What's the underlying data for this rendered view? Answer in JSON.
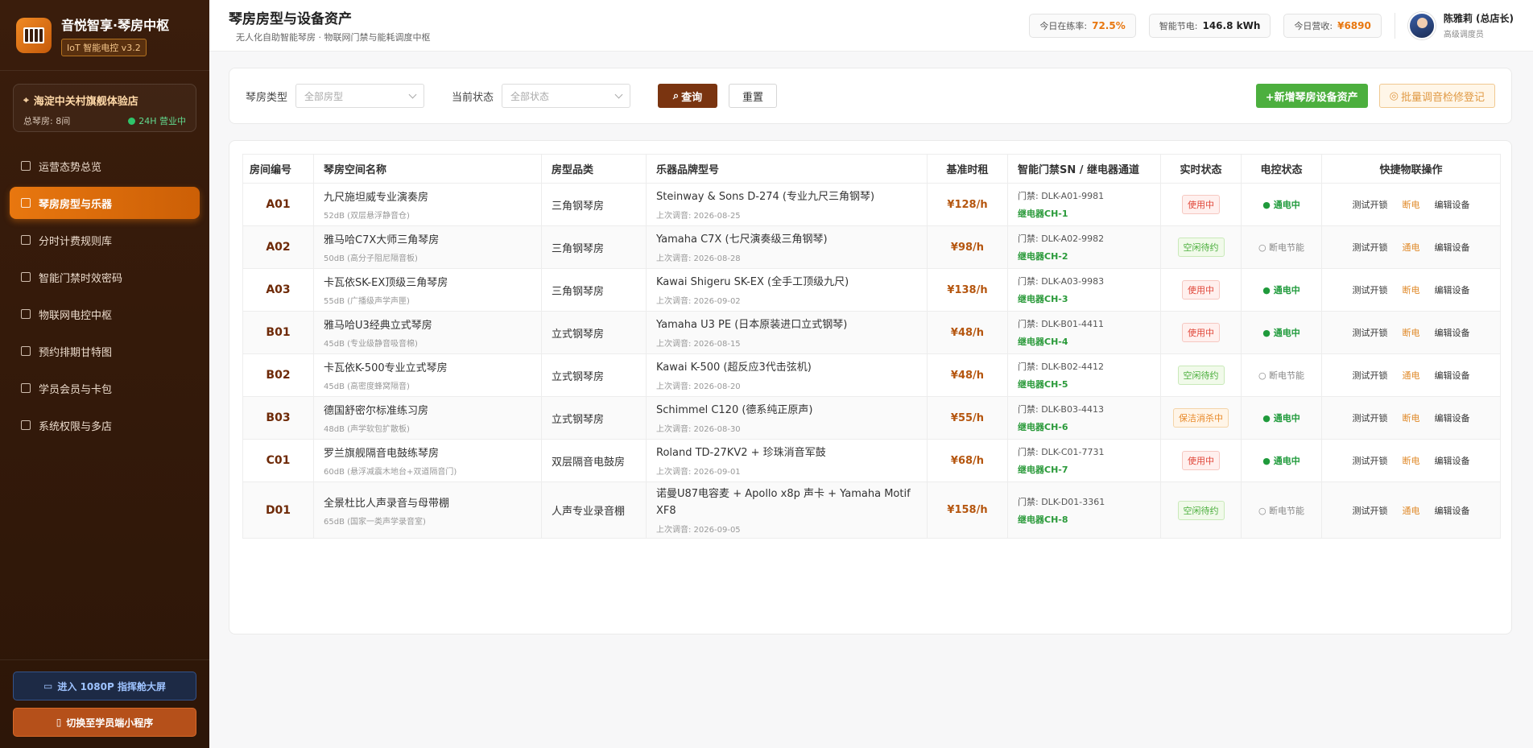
{
  "brand": {
    "title": "音悦智享·琴房中枢",
    "badge": "IoT 智能电控 v3.2"
  },
  "store": {
    "name": "海淀中关村旗舰体验店",
    "rooms_label": "总琴房: 8间",
    "open_label": "24H 营业中"
  },
  "nav": [
    {
      "label": "运营态势总览",
      "icon": "chart-icon",
      "active": false
    },
    {
      "label": "琴房房型与乐器",
      "icon": "home-icon",
      "active": true
    },
    {
      "label": "分时计费规则库",
      "icon": "ticket-icon",
      "active": false
    },
    {
      "label": "智能门禁时效密码",
      "icon": "lock-icon",
      "active": false
    },
    {
      "label": "物联网电控中枢",
      "icon": "cloud-icon",
      "active": false
    },
    {
      "label": "预约排期甘特图",
      "icon": "calendar-icon",
      "active": false
    },
    {
      "label": "学员会员与卡包",
      "icon": "folder-icon",
      "active": false
    },
    {
      "label": "系统权限与多店",
      "icon": "gear-icon",
      "active": false
    }
  ],
  "side_buttons": {
    "screen": "进入 1080P 指挥舱大屏",
    "mini": "切换至学员端小程序"
  },
  "header": {
    "title": "琴房房型与设备资产",
    "subtitle": "无人化自助智能琴房 · 物联网门禁与能耗调度中枢"
  },
  "stats": [
    {
      "label": "今日在练率:",
      "value": "72.5%",
      "color": "#e8770f"
    },
    {
      "label": "智能节电:",
      "value": "146.8 kWh",
      "color": "#222222"
    },
    {
      "label": "今日营收:",
      "value": "¥6890",
      "color": "#e8770f"
    }
  ],
  "user": {
    "name": "陈雅莉 (总店长)",
    "role": "高级调度员"
  },
  "filter": {
    "type_label": "琴房类型",
    "type_placeholder": "全部房型",
    "status_label": "当前状态",
    "status_placeholder": "全部状态",
    "query": "查询",
    "reset": "重置",
    "add": "+新增琴房设备资产",
    "batch": "批量调音检修登记"
  },
  "table": {
    "headers": [
      "房间编号",
      "琴房空间名称",
      "房型品类",
      "乐器品牌型号",
      "基准时租",
      "智能门禁SN / 继电器通道",
      "实时状态",
      "电控状态",
      "快捷物联操作"
    ],
    "rows": [
      {
        "id": "A01",
        "name": "九尺施坦威专业演奏房",
        "db": "52dB (双层悬浮静音仓)",
        "type": "三角钢琴房",
        "inst": "Steinway & Sons D-274 (专业九尺三角钢琴)",
        "tune": "上次调音: 2026-08-25",
        "price": "¥128/h",
        "door": "门禁: DLK-A01-9981",
        "relay": "继电器CH-1",
        "status": "使用中",
        "skind": "busy",
        "power": "● 通电中",
        "pon": true,
        "a1": "测试开锁",
        "a2": "断电",
        "a3": "编辑设备"
      },
      {
        "id": "A02",
        "name": "雅马哈C7X大师三角琴房",
        "db": "50dB (高分子阻尼隔音板)",
        "type": "三角钢琴房",
        "inst": "Yamaha C7X (七尺演奏级三角钢琴)",
        "tune": "上次调音: 2026-08-28",
        "price": "¥98/h",
        "door": "门禁: DLK-A02-9982",
        "relay": "继电器CH-2",
        "status": "空闲待约",
        "skind": "idle",
        "power": "○ 断电节能",
        "pon": false,
        "a1": "测试开锁",
        "a2": "通电",
        "a3": "编辑设备"
      },
      {
        "id": "A03",
        "name": "卡瓦依SK-EX顶级三角琴房",
        "db": "55dB (广播级声学声匣)",
        "type": "三角钢琴房",
        "inst": "Kawai Shigeru SK-EX (全手工顶级九尺)",
        "tune": "上次调音: 2026-09-02",
        "price": "¥138/h",
        "door": "门禁: DLK-A03-9983",
        "relay": "继电器CH-3",
        "status": "使用中",
        "skind": "busy",
        "power": "● 通电中",
        "pon": true,
        "a1": "测试开锁",
        "a2": "断电",
        "a3": "编辑设备"
      },
      {
        "id": "B01",
        "name": "雅马哈U3经典立式琴房",
        "db": "45dB (专业级静音吸音棉)",
        "type": "立式钢琴房",
        "inst": "Yamaha U3 PE (日本原装进口立式钢琴)",
        "tune": "上次调音: 2026-08-15",
        "price": "¥48/h",
        "door": "门禁: DLK-B01-4411",
        "relay": "继电器CH-4",
        "status": "使用中",
        "skind": "busy",
        "power": "● 通电中",
        "pon": true,
        "a1": "测试开锁",
        "a2": "断电",
        "a3": "编辑设备"
      },
      {
        "id": "B02",
        "name": "卡瓦依K-500专业立式琴房",
        "db": "45dB (高密度蜂窝隔音)",
        "type": "立式钢琴房",
        "inst": "Kawai K-500 (超反应3代击弦机)",
        "tune": "上次调音: 2026-08-20",
        "price": "¥48/h",
        "door": "门禁: DLK-B02-4412",
        "relay": "继电器CH-5",
        "status": "空闲待约",
        "skind": "idle",
        "power": "○ 断电节能",
        "pon": false,
        "a1": "测试开锁",
        "a2": "通电",
        "a3": "编辑设备"
      },
      {
        "id": "B03",
        "name": "德国舒密尔标准练习房",
        "db": "48dB (声学软包扩散板)",
        "type": "立式钢琴房",
        "inst": "Schimmel C120 (德系纯正原声)",
        "tune": "上次调音: 2026-08-30",
        "price": "¥55/h",
        "door": "门禁: DLK-B03-4413",
        "relay": "继电器CH-6",
        "status": "保洁消杀中",
        "skind": "clean",
        "power": "● 通电中",
        "pon": true,
        "a1": "测试开锁",
        "a2": "断电",
        "a3": "编辑设备"
      },
      {
        "id": "C01",
        "name": "罗兰旗舰隔音电鼓练琴房",
        "db": "60dB (悬浮减震木地台+双道隔音门)",
        "type": "双层隔音电鼓房",
        "inst": "Roland TD-27KV2 + 珍珠消音军鼓",
        "tune": "上次调音: 2026-09-01",
        "price": "¥68/h",
        "door": "门禁: DLK-C01-7731",
        "relay": "继电器CH-7",
        "status": "使用中",
        "skind": "busy",
        "power": "● 通电中",
        "pon": true,
        "a1": "测试开锁",
        "a2": "断电",
        "a3": "编辑设备"
      },
      {
        "id": "D01",
        "name": "全景杜比人声录音与母带棚",
        "db": "65dB (国家一类声学录音室)",
        "type": "人声专业录音棚",
        "inst": "诺曼U87电容麦 + Apollo x8p 声卡 + Yamaha Motif XF8",
        "tune": "上次调音: 2026-09-05",
        "price": "¥158/h",
        "door": "门禁: DLK-D01-3361",
        "relay": "继电器CH-8",
        "status": "空闲待约",
        "skind": "idle",
        "power": "○ 断电节能",
        "pon": false,
        "a1": "测试开锁",
        "a2": "通电",
        "a3": "编辑设备"
      }
    ]
  }
}
